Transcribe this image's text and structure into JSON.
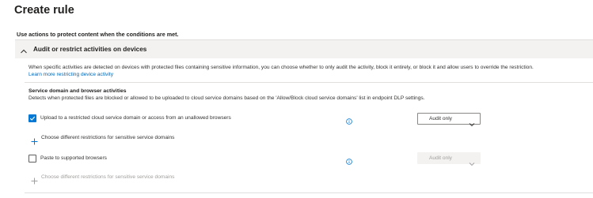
{
  "page": {
    "title": "Create rule",
    "subtitle": "Use actions to protect content when the conditions are met."
  },
  "section": {
    "title": "Audit or restrict activities on devices",
    "expanded": true,
    "chevron_icon": "chevron-up-icon",
    "description": "When specific activities are detected on devices with protected files containing sensitive information, you can choose whether to only audit the activity, block it entirely, or block it and allow users to override the restriction.",
    "learn_more_link": "Learn more restricting device activity"
  },
  "service_domain_group": {
    "title": "Service domain and browser activities",
    "description": "Detects when protected files are blocked or allowed to be uploaded to cloud service domains based on the 'Allow/Block cloud service domains' list in endpoint DLP settings.",
    "rows": [
      {
        "label": "Upload to a restricted cloud service domain or access from an unallowed browsers",
        "checked": true,
        "info_icon": "info-icon",
        "action_value": "Audit only",
        "action_enabled": true,
        "add_restriction_label": "Choose different restrictions for sensitive service domains",
        "add_restriction_enabled": true
      },
      {
        "label": "Paste to supported browsers",
        "checked": false,
        "info_icon": "info-icon",
        "action_value": "Audit only",
        "action_enabled": false,
        "add_restriction_label": "Choose different restrictions for sensitive service domains",
        "add_restriction_enabled": false
      }
    ]
  },
  "colors": {
    "accent": "#0078d4",
    "link": "#0067b8",
    "section_header_bg": "#f3f2f1",
    "disabled_text": "#a19f9d"
  }
}
